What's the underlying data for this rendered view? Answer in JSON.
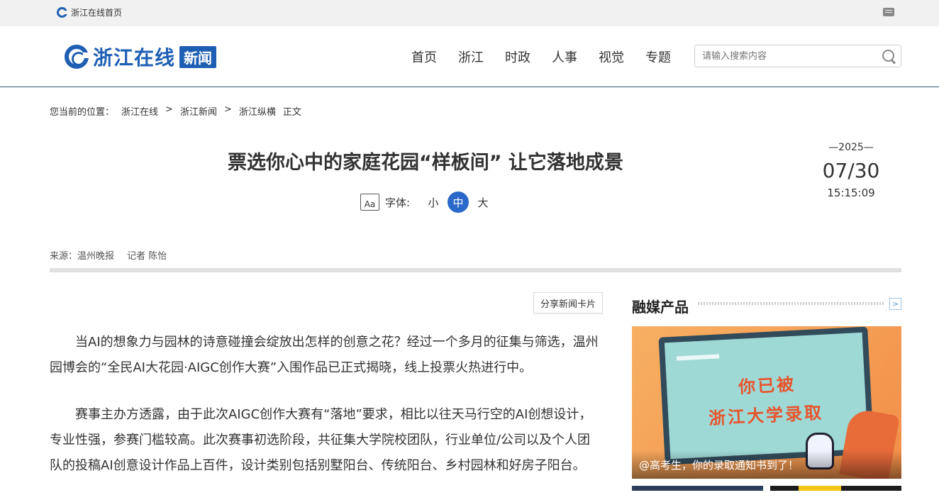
{
  "topbar": {
    "home_link": "浙江在线首页"
  },
  "header": {
    "brand_name": "浙江在线",
    "brand_tag": "新闻",
    "nav": [
      "首页",
      "浙江",
      "时政",
      "人事",
      "视觉",
      "专题"
    ],
    "search_placeholder": "请输入搜索内容"
  },
  "breadcrumb": {
    "prefix": "您当前的位置：",
    "items": [
      "浙江在线",
      ">",
      "浙江新闻",
      ">",
      "浙江纵横",
      "正文"
    ]
  },
  "article": {
    "title": "票选你心中的家庭花园“样板间” 让它落地成景",
    "font_label": "字体:",
    "font_icon": "Aa",
    "font_options": [
      "小",
      "中",
      "大"
    ],
    "font_selected": "中",
    "date_year": "—2025—",
    "date_md": "07/30",
    "date_time": "15:15:09",
    "source": "来源：温州晚报",
    "reporter": "记者 陈怡",
    "share_button": "分享新闻卡片",
    "paragraphs": [
      "当AI的想象力与园林的诗意碰撞会绽放出怎样的创意之花？经过一个多月的征集与筛选，温州园博会的“全民AI大花园·AIGC创作大赛”入围作品已正式揭晓，线上投票火热进行中。",
      "赛事主办方透露，由于此次AIGC创作大赛有“落地”要求，相比以往天马行空的AI创想设计，专业性强，参赛门槛较高。此次赛事初选阶段，共征集大学院校团队，行业单位/公司以及个人团队的投稿AI创意设计作品上百件，设计类别包括别墅阳台、传统阳台、乡村园林和好房子阳台。"
    ]
  },
  "sidebar": {
    "section_title": "融媒产品",
    "more_icon": "chevron-right-icon",
    "promo_line1": "你已被",
    "promo_line2": "浙江大学录取",
    "promo_caption": "@高考生，你的录取通知书到了！"
  },
  "colors": {
    "brand": "#1e5fb4",
    "accent": "#2a68c9"
  }
}
